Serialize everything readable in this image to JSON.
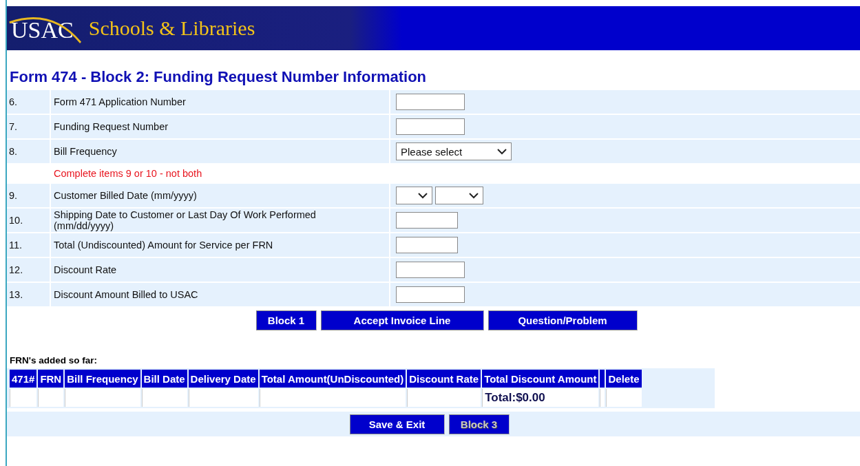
{
  "header": {
    "logo_left": "USAC",
    "logo_right": "Schools & Libraries"
  },
  "title": "Form 474 - Block 2: Funding Request Number Information",
  "rows": [
    {
      "kind": "text",
      "number": "6.",
      "label": "Form 471 Application Number"
    },
    {
      "kind": "text",
      "number": "7.",
      "label": "Funding Request Number"
    },
    {
      "kind": "select",
      "number": "8.",
      "label": "Bill Frequency",
      "value": "Please select"
    },
    {
      "kind": "note",
      "label": "Complete items 9 or 10 - not both"
    },
    {
      "kind": "date-select",
      "number": "9.",
      "label": "Customer Billed Date (mm/yyyy)"
    },
    {
      "kind": "text",
      "number": "10.",
      "label": "Shipping Date to Customer or Last Day Of Work Performed (mm/dd/yyyy)"
    },
    {
      "kind": "text",
      "number": "11.",
      "label": "Total (Undiscounted) Amount for Service per FRN"
    },
    {
      "kind": "text",
      "number": "12.",
      "label": "Discount Rate"
    },
    {
      "kind": "text",
      "number": "13.",
      "label": "Discount Amount Billed to USAC"
    }
  ],
  "form_buttons": [
    {
      "label": "Block 1",
      "disabled": false
    },
    {
      "label": "Accept Invoice Line",
      "disabled": false
    },
    {
      "label": "Question/Problem",
      "disabled": false
    }
  ],
  "frn_heading": "FRN's added so far:",
  "table": {
    "columns": [
      "471#",
      "FRN",
      "Bill Frequency",
      "Bill Date",
      "Delivery Date",
      "Total Amount(UnDiscounted)",
      "Discount Rate",
      "Total Discount Amount",
      "",
      "Delete"
    ],
    "total": "Total:$0.00"
  },
  "bottom_buttons": [
    {
      "label": "Save & Exit",
      "disabled": false
    },
    {
      "label": "Block 3",
      "disabled": true
    }
  ]
}
